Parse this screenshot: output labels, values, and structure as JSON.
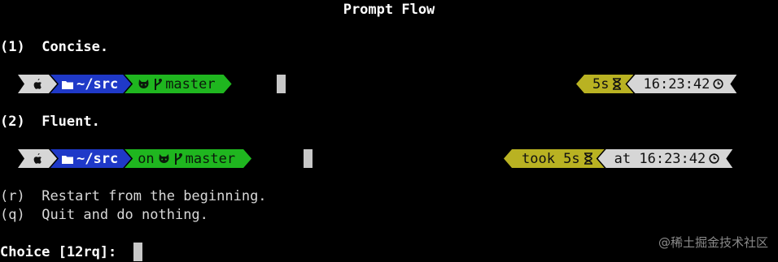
{
  "title": "Prompt Flow",
  "options": [
    {
      "key": "(1)",
      "label": "Concise.",
      "left": {
        "dir": "~/src",
        "git_prefix": "",
        "branch": "master"
      },
      "right": {
        "duration": "5s",
        "time": "16:23:42"
      }
    },
    {
      "key": "(2)",
      "label": "Fluent.",
      "left": {
        "dir": "~/src",
        "git_prefix": "on",
        "branch": "master"
      },
      "right": {
        "duration": "took 5s",
        "time": "at 16:23:42"
      }
    }
  ],
  "actions": [
    {
      "key": "(r)",
      "label": "Restart from the beginning."
    },
    {
      "key": "(q)",
      "label": "Quit and do nothing."
    }
  ],
  "choice_prompt": "Choice [12rq]:",
  "watermark": "@稀土掘金技术社区",
  "icons": {
    "os": "apple-icon",
    "folder": "folder-icon",
    "github": "github-icon",
    "branch": "git-branch-icon",
    "hourglass": "hourglass-icon",
    "clock": "clock-icon"
  },
  "colors": {
    "os_segment": "#d6d6d6",
    "dir_segment": "#1f39c8",
    "git_segment": "#1fb61f",
    "duration_segment": "#b9b222",
    "time_segment": "#d6d6d6"
  }
}
